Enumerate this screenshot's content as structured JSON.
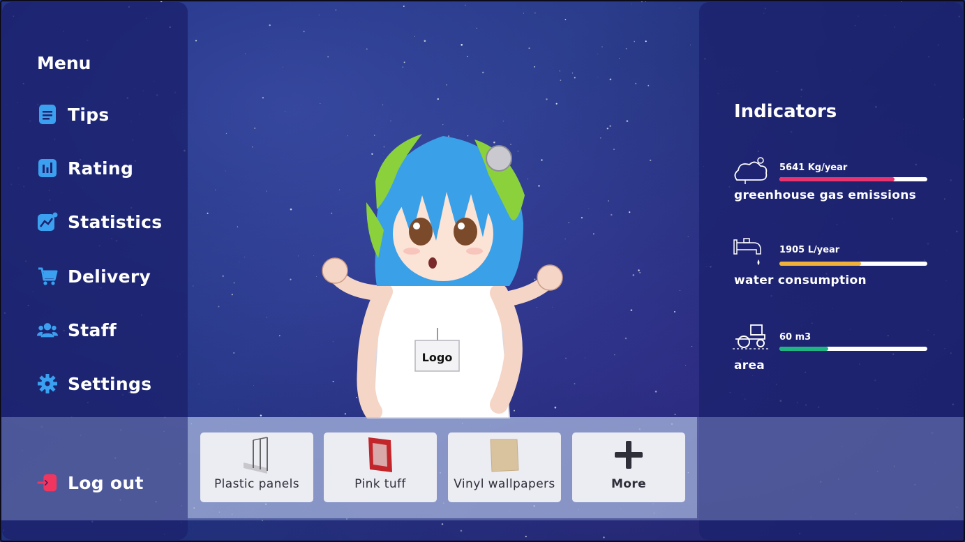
{
  "menu": {
    "title": "Menu",
    "items": [
      {
        "label": "Tips",
        "icon": "document-icon"
      },
      {
        "label": "Rating",
        "icon": "bar-chart-icon"
      },
      {
        "label": "Statistics",
        "icon": "trend-chart-icon"
      },
      {
        "label": "Delivery",
        "icon": "cart-icon"
      },
      {
        "label": "Staff",
        "icon": "users-icon"
      },
      {
        "label": "Settings",
        "icon": "gear-icon"
      }
    ],
    "logout": "Log out",
    "icon_color": "#3ba0f0",
    "logout_color": "#f0365f"
  },
  "character": {
    "badge": "Logo"
  },
  "toolbar": {
    "items": [
      {
        "label": "Plastic panels",
        "icon": "panel-icon"
      },
      {
        "label": "Pink tuff",
        "icon": "frame-icon"
      },
      {
        "label": "Vinyl wallpapers",
        "icon": "wallpaper-icon"
      },
      {
        "label": "More",
        "icon": "plus-icon"
      }
    ]
  },
  "indicators": {
    "title": "Indicators",
    "items": [
      {
        "value": "5641 Kg/year",
        "name": "greenhouse gas emissions",
        "level": 0.78,
        "color": "#e8346e",
        "icon": "cloud-sun-icon"
      },
      {
        "value": "1905 L/year",
        "name": "water consumption",
        "level": 0.55,
        "color": "#f0b13a",
        "icon": "faucet-icon"
      },
      {
        "value": "60 m3",
        "name": "area",
        "level": 0.33,
        "color": "#1fb582",
        "icon": "tractor-icon"
      }
    ]
  }
}
